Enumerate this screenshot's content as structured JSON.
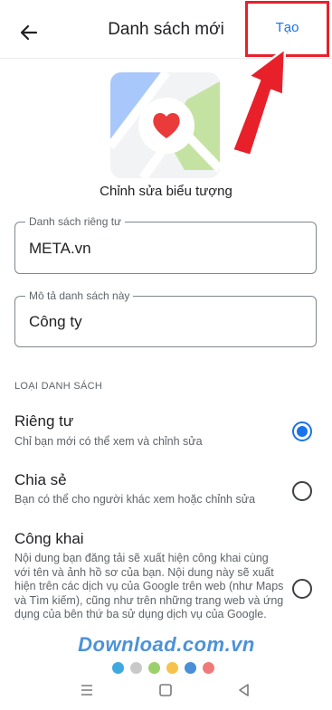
{
  "header": {
    "back_icon": "arrow-left-icon",
    "title": "Danh sách mới",
    "create_label": "Tạo",
    "highlight_color": "#e8202a",
    "accent_color": "#1a73e8"
  },
  "icon_section": {
    "icon": "map-heart-icon",
    "edit_label": "Chỉnh sửa biểu tượng"
  },
  "form": {
    "name_field": {
      "label": "Danh sách riêng tư",
      "value": "META.vn"
    },
    "description_field": {
      "label": "Mô tả danh sách này",
      "value": "Công ty"
    }
  },
  "list_type": {
    "header": "LOẠI DANH SÁCH",
    "options": [
      {
        "title": "Riêng tư",
        "description": "Chỉ bạn mới có thể xem và chỉnh sửa",
        "selected": true
      },
      {
        "title": "Chia sẻ",
        "description": "Bạn có thể cho người khác xem hoặc chỉnh sửa",
        "selected": false
      },
      {
        "title": "Công khai",
        "description": "Nội dung bạn đăng tải sẽ xuất hiện công khai cùng với tên và ảnh hồ sơ của bạn. Nội dung này sẽ xuất hiện trên các dịch vụ của Google trên web (như Maps và Tìm kiếm), cũng như trên những trang web và ứng dụng của bên thứ ba sử dụng dịch vụ của Google. Các danh sách của bạn phải tuân thủ chính sách của Google. Đọc thêm",
        "selected": false
      }
    ]
  },
  "watermark": {
    "text": "Download.com.vn",
    "dot_colors": [
      "#3ea8e0",
      "#c9c9c9",
      "#9bd06a",
      "#f6c24b",
      "#4a8fd8",
      "#f07a7a"
    ]
  },
  "nav_bar": {
    "icons": [
      "menu-icon",
      "home-square-icon",
      "back-triangle-icon"
    ]
  }
}
